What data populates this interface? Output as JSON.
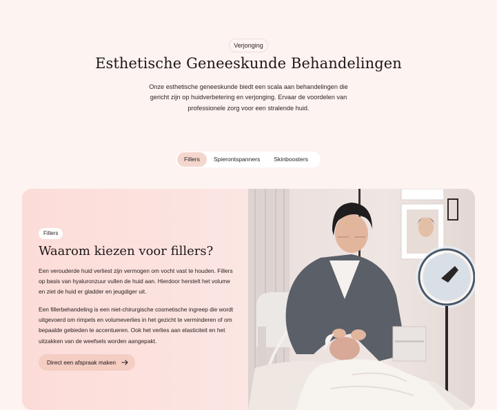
{
  "hero": {
    "eyebrow": "Verjonging",
    "title": "Esthetische Geneeskunde Behandelingen",
    "intro": "Onze esthetische geneeskunde biedt een scala aan behandelingen die gericht zijn op huidverbetering en verjonging. Ervaar de voordelen van professionele zorg voor een stralende huid."
  },
  "tabs": [
    {
      "label": "Fillers",
      "active": true
    },
    {
      "label": "Spierontspanners",
      "active": false
    },
    {
      "label": "Skinboosters",
      "active": false
    }
  ],
  "card": {
    "pill": "Fillers",
    "title": "Waarom kiezen voor fillers?",
    "paragraph1": "Een verouderde huid verliest zijn vermogen om vocht vast te houden. Fillers op basis van hyaluronzuur vullen de huid aan. Hierdoor herstelt het volume en ziet de huid er gladder en jeugdiger uit.",
    "paragraph2": "Een fillerbehandeling is een niet-chirurgische cosmetische ingreep die wordt uitgevoerd om rimpels en volumeverlies in het gezicht te verminderen of om bepaalde gebieden te accentueren. Ook het verlies aan elasticiteit en het uitzakken van de weefsels worden aangepakt.",
    "cta_label": "Direct een afspraak maken",
    "cta_icon": "arrow-right-icon"
  },
  "colors": {
    "background": "#fdf3f1",
    "active_tab": "#f5d6ce",
    "card_bg": "#fcdcd8",
    "cta_bg": "#f4cdc3"
  }
}
